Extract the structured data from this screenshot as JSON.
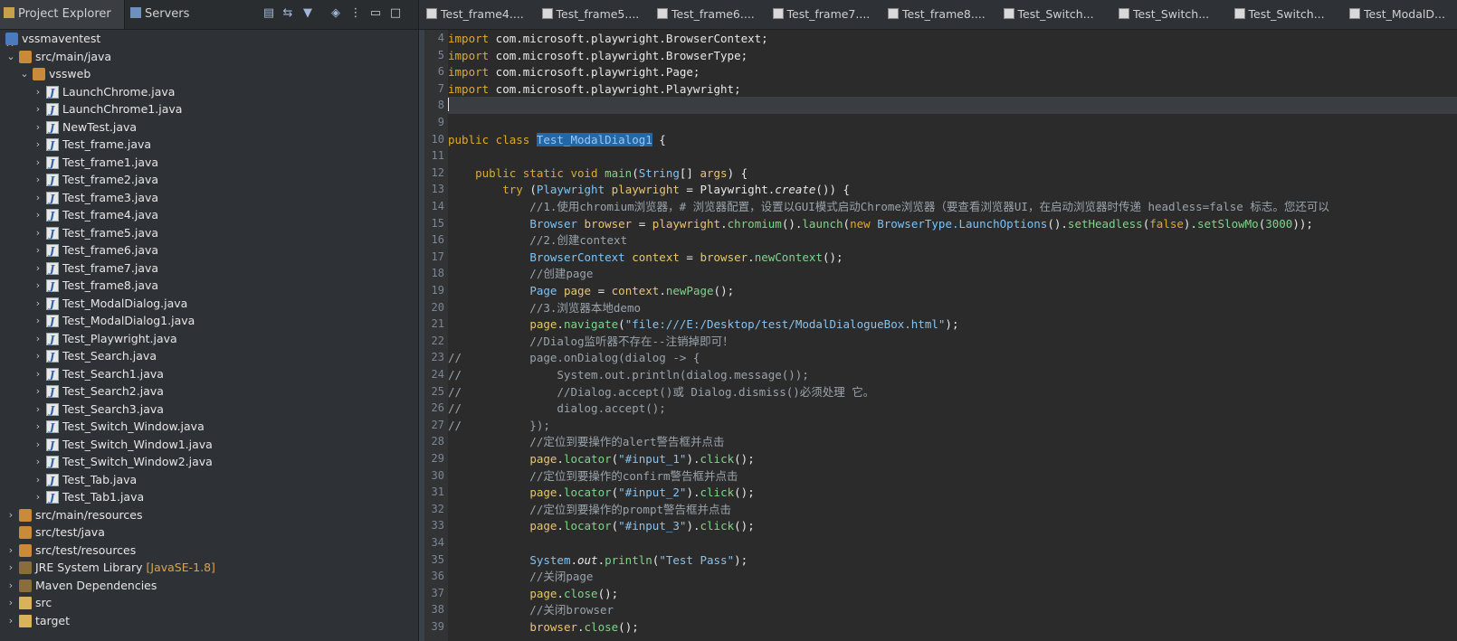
{
  "left_panel": {
    "tabs": [
      {
        "label": "Project Explorer",
        "active": true
      },
      {
        "label": "Servers",
        "active": false
      }
    ],
    "toolbar_icons": [
      "collapse-all-icon",
      "link-with-editor-icon",
      "filter-icon",
      "focus-icon",
      "view-menu-icon",
      "minimize-icon",
      "maximize-icon"
    ],
    "tree": [
      {
        "label": "vssmaventest",
        "depth": 0,
        "expanded": true,
        "icon": "project-icon"
      },
      {
        "label": "src/main/java",
        "depth": 1,
        "expanded": true,
        "icon": "source-folder-icon"
      },
      {
        "label": "vssweb",
        "depth": 2,
        "expanded": true,
        "icon": "package-icon"
      },
      {
        "label": "LaunchChrome.java",
        "depth": 3,
        "icon": "java-file-icon"
      },
      {
        "label": "LaunchChrome1.java",
        "depth": 3,
        "icon": "java-file-icon"
      },
      {
        "label": "NewTest.java",
        "depth": 3,
        "icon": "java-file-icon"
      },
      {
        "label": "Test_frame.java",
        "depth": 3,
        "icon": "java-file-icon"
      },
      {
        "label": "Test_frame1.java",
        "depth": 3,
        "icon": "java-file-icon"
      },
      {
        "label": "Test_frame2.java",
        "depth": 3,
        "icon": "java-file-icon"
      },
      {
        "label": "Test_frame3.java",
        "depth": 3,
        "icon": "java-file-icon"
      },
      {
        "label": "Test_frame4.java",
        "depth": 3,
        "icon": "java-file-icon"
      },
      {
        "label": "Test_frame5.java",
        "depth": 3,
        "icon": "java-file-icon"
      },
      {
        "label": "Test_frame6.java",
        "depth": 3,
        "icon": "java-file-icon"
      },
      {
        "label": "Test_frame7.java",
        "depth": 3,
        "icon": "java-file-icon"
      },
      {
        "label": "Test_frame8.java",
        "depth": 3,
        "icon": "java-file-icon"
      },
      {
        "label": "Test_ModalDialog.java",
        "depth": 3,
        "icon": "java-file-icon"
      },
      {
        "label": "Test_ModalDialog1.java",
        "depth": 3,
        "icon": "java-file-icon"
      },
      {
        "label": "Test_Playwright.java",
        "depth": 3,
        "icon": "java-file-icon"
      },
      {
        "label": "Test_Search.java",
        "depth": 3,
        "icon": "java-file-icon"
      },
      {
        "label": "Test_Search1.java",
        "depth": 3,
        "icon": "java-file-icon"
      },
      {
        "label": "Test_Search2.java",
        "depth": 3,
        "icon": "java-file-icon"
      },
      {
        "label": "Test_Search3.java",
        "depth": 3,
        "icon": "java-file-icon"
      },
      {
        "label": "Test_Switch_Window.java",
        "depth": 3,
        "icon": "java-file-icon"
      },
      {
        "label": "Test_Switch_Window1.java",
        "depth": 3,
        "icon": "java-file-icon"
      },
      {
        "label": "Test_Switch_Window2.java",
        "depth": 3,
        "icon": "java-file-icon"
      },
      {
        "label": "Test_Tab.java",
        "depth": 3,
        "icon": "java-file-icon"
      },
      {
        "label": "Test_Tab1.java",
        "depth": 3,
        "icon": "java-file-icon"
      },
      {
        "label": "src/main/resources",
        "depth": 1,
        "expanded": false,
        "icon": "source-folder-icon"
      },
      {
        "label": "src/test/java",
        "depth": 1,
        "icon": "source-folder-icon",
        "no_chevron": true
      },
      {
        "label": "src/test/resources",
        "depth": 1,
        "expanded": false,
        "icon": "source-folder-icon"
      },
      {
        "label": "JRE System Library",
        "decoration": "[JavaSE-1.8]",
        "depth": 1,
        "expanded": false,
        "icon": "library-icon"
      },
      {
        "label": "Maven Dependencies",
        "depth": 1,
        "expanded": false,
        "icon": "library-icon"
      },
      {
        "label": "src",
        "depth": 1,
        "expanded": false,
        "icon": "folder-icon"
      },
      {
        "label": "target",
        "depth": 1,
        "expanded": false,
        "icon": "folder-icon"
      }
    ]
  },
  "editor": {
    "tabs": [
      "Test_frame4....",
      "Test_frame5....",
      "Test_frame6....",
      "Test_frame7....",
      "Test_frame8....",
      "Test_Switch...",
      "Test_Switch...",
      "Test_Switch...",
      "Test_ModalD..."
    ],
    "current_line": 8,
    "lines": [
      {
        "n": 4,
        "t": [
          [
            "import",
            "kw"
          ],
          [
            " com.microsoft.playwright.BrowserContext;",
            ""
          ]
        ]
      },
      {
        "n": 5,
        "t": [
          [
            "import",
            "kw"
          ],
          [
            " com.microsoft.playwright.BrowserType;",
            ""
          ]
        ]
      },
      {
        "n": 6,
        "t": [
          [
            "import",
            "kw"
          ],
          [
            " com.microsoft.playwright.Page;",
            ""
          ]
        ]
      },
      {
        "n": 7,
        "t": [
          [
            "import",
            "kw"
          ],
          [
            " com.microsoft.playwright.Playwright;",
            ""
          ]
        ]
      },
      {
        "n": 8,
        "t": []
      },
      {
        "n": 9,
        "t": []
      },
      {
        "n": 10,
        "t": [
          [
            "public class ",
            "kw"
          ],
          [
            "Test_ModalDialog1",
            "sel"
          ],
          [
            " {",
            ""
          ]
        ]
      },
      {
        "n": 11,
        "t": []
      },
      {
        "n": 12,
        "t": [
          [
            "    public static void ",
            "kw"
          ],
          [
            "main",
            "fn"
          ],
          [
            "(",
            ""
          ],
          [
            "String",
            "ty"
          ],
          [
            "[] ",
            ""
          ],
          [
            "args",
            "vr"
          ],
          [
            ") {",
            ""
          ]
        ]
      },
      {
        "n": 13,
        "t": [
          [
            "        try ",
            "kw"
          ],
          [
            "(",
            ""
          ],
          [
            "Playwright ",
            "ty"
          ],
          [
            "playwright",
            "vr"
          ],
          [
            " = Playwright.",
            ""
          ],
          [
            "create",
            "it"
          ],
          [
            "()) {",
            ""
          ]
        ]
      },
      {
        "n": 14,
        "t": [
          [
            "            //1.使用chromium浏览器，# 浏览器配置，设置以GUI模式启动Chrome浏览器（要查看浏览器UI，在启动浏览器时传递 headless=false 标志。您还可以",
            ""
          ]
        ]
      },
      {
        "n": 15,
        "t": [
          [
            "            ",
            ""
          ],
          [
            "Browser ",
            "ty"
          ],
          [
            "browser",
            "vr"
          ],
          [
            " = ",
            ""
          ],
          [
            "playwright",
            "vr"
          ],
          [
            ".",
            ""
          ],
          [
            "chromium",
            "fn"
          ],
          [
            "().",
            ""
          ],
          [
            "launch",
            "fn"
          ],
          [
            "(",
            ""
          ],
          [
            "new ",
            "kw"
          ],
          [
            "BrowserType.LaunchOptions",
            "ty"
          ],
          [
            "().",
            ""
          ],
          [
            "setHeadless",
            "fn"
          ],
          [
            "(",
            ""
          ],
          [
            "false",
            "kw"
          ],
          [
            ").",
            ""
          ],
          [
            "setSlowMo",
            "fn"
          ],
          [
            "(",
            ""
          ],
          [
            "3000",
            "num"
          ],
          [
            "));",
            ""
          ]
        ]
      },
      {
        "n": 16,
        "t": [
          [
            "            //2.创建context",
            ""
          ]
        ]
      },
      {
        "n": 17,
        "t": [
          [
            "            ",
            ""
          ],
          [
            "BrowserContext ",
            "ty"
          ],
          [
            "context",
            "vr"
          ],
          [
            " = ",
            ""
          ],
          [
            "browser",
            "vr"
          ],
          [
            ".",
            ""
          ],
          [
            "newContext",
            "fn"
          ],
          [
            "();",
            ""
          ]
        ]
      },
      {
        "n": 18,
        "t": [
          [
            "            //创建page",
            ""
          ]
        ]
      },
      {
        "n": 19,
        "t": [
          [
            "            ",
            ""
          ],
          [
            "Page ",
            "ty"
          ],
          [
            "page",
            "vr"
          ],
          [
            " = ",
            ""
          ],
          [
            "context",
            "vr"
          ],
          [
            ".",
            ""
          ],
          [
            "newPage",
            "fn"
          ],
          [
            "();",
            ""
          ]
        ]
      },
      {
        "n": 20,
        "t": [
          [
            "            //3.浏览器本地demo",
            ""
          ]
        ]
      },
      {
        "n": 21,
        "t": [
          [
            "            ",
            ""
          ],
          [
            "page",
            "vr"
          ],
          [
            ".",
            ""
          ],
          [
            "navigate",
            "fn"
          ],
          [
            "(",
            ""
          ],
          [
            "\"file:///E:/Desktop/test/ModalDialogueBox.html\"",
            "st"
          ],
          [
            ");",
            ""
          ]
        ]
      },
      {
        "n": 22,
        "t": [
          [
            "            //Dialog监听器不存在--注销掉即可！",
            ""
          ]
        ]
      },
      {
        "n": 23,
        "t": [
          [
            "//          page.onDialog(dialog -> {",
            ""
          ]
        ]
      },
      {
        "n": 24,
        "t": [
          [
            "//              System.out.println(dialog.message());",
            ""
          ]
        ]
      },
      {
        "n": 25,
        "t": [
          [
            "//              //Dialog.accept()或 Dialog.dismiss()必须处理 它。",
            ""
          ]
        ]
      },
      {
        "n": 26,
        "t": [
          [
            "//              dialog.accept();",
            ""
          ]
        ]
      },
      {
        "n": 27,
        "t": [
          [
            "//          });",
            ""
          ]
        ]
      },
      {
        "n": 28,
        "t": [
          [
            "            //定位到要操作的alert警告框并点击",
            ""
          ]
        ]
      },
      {
        "n": 29,
        "t": [
          [
            "            ",
            ""
          ],
          [
            "page",
            "vr"
          ],
          [
            ".",
            ""
          ],
          [
            "locator",
            "fn"
          ],
          [
            "(",
            ""
          ],
          [
            "\"#input_1\"",
            "st"
          ],
          [
            ").",
            ""
          ],
          [
            "click",
            "fn"
          ],
          [
            "();",
            ""
          ]
        ]
      },
      {
        "n": 30,
        "t": [
          [
            "            //定位到要操作的confirm警告框并点击",
            ""
          ]
        ]
      },
      {
        "n": 31,
        "t": [
          [
            "            ",
            ""
          ],
          [
            "page",
            "vr"
          ],
          [
            ".",
            ""
          ],
          [
            "locator",
            "fn"
          ],
          [
            "(",
            ""
          ],
          [
            "\"#input_2\"",
            "st"
          ],
          [
            ").",
            ""
          ],
          [
            "click",
            "fn"
          ],
          [
            "();",
            ""
          ]
        ]
      },
      {
        "n": 32,
        "t": [
          [
            "            //定位到要操作的prompt警告框并点击",
            ""
          ]
        ]
      },
      {
        "n": 33,
        "t": [
          [
            "            ",
            ""
          ],
          [
            "page",
            "vr"
          ],
          [
            ".",
            ""
          ],
          [
            "locator",
            "fn"
          ],
          [
            "(",
            ""
          ],
          [
            "\"#input_3\"",
            "st"
          ],
          [
            ").",
            ""
          ],
          [
            "click",
            "fn"
          ],
          [
            "();",
            ""
          ]
        ]
      },
      {
        "n": 34,
        "t": []
      },
      {
        "n": 35,
        "t": [
          [
            "            ",
            ""
          ],
          [
            "System",
            "ty"
          ],
          [
            ".",
            ""
          ],
          [
            "out",
            "it"
          ],
          [
            ".",
            ""
          ],
          [
            "println",
            "fn"
          ],
          [
            "(",
            ""
          ],
          [
            "\"Test Pass\"",
            "st"
          ],
          [
            ");",
            ""
          ]
        ]
      },
      {
        "n": 36,
        "t": [
          [
            "            //关闭page",
            ""
          ]
        ]
      },
      {
        "n": 37,
        "t": [
          [
            "            ",
            ""
          ],
          [
            "page",
            "vr"
          ],
          [
            ".",
            ""
          ],
          [
            "close",
            "fn"
          ],
          [
            "();",
            ""
          ]
        ]
      },
      {
        "n": 38,
        "t": [
          [
            "            //关闭browser",
            ""
          ]
        ]
      },
      {
        "n": 39,
        "t": [
          [
            "            ",
            ""
          ],
          [
            "browser",
            "vr"
          ],
          [
            ".",
            ""
          ],
          [
            "close",
            "fn"
          ],
          [
            "();",
            ""
          ]
        ]
      }
    ]
  }
}
